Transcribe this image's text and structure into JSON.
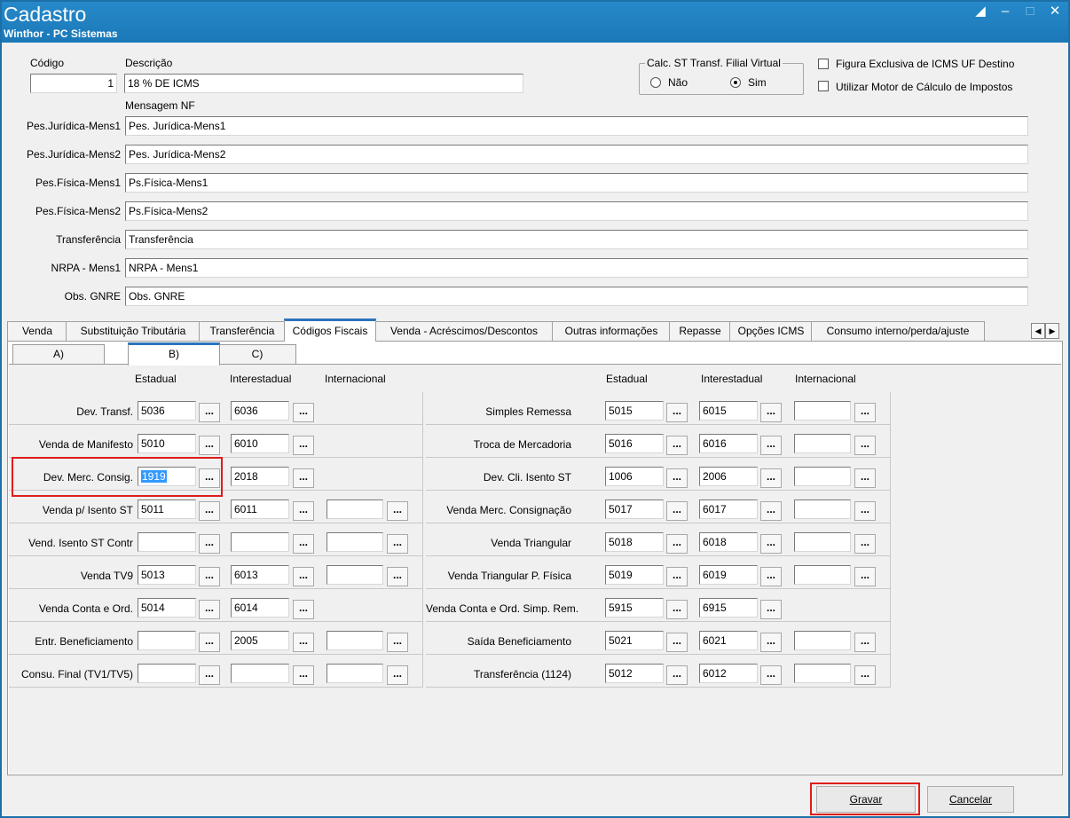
{
  "window": {
    "title": "Cadastro",
    "subtitle": "Winthor - PC Sistemas",
    "icons": [
      "restore-icon",
      "minimize-icon",
      "maximize-icon",
      "close-icon"
    ]
  },
  "header": {
    "codigo_label": "Código",
    "codigo_value": "1",
    "descricao_label": "Descrição",
    "descricao_value": "18 % DE ICMS",
    "calc_st_legend": "Calc. ST Transf. Filial Virtual",
    "radio_nao": "Não",
    "radio_sim": "Sim",
    "radio_selected": "Sim",
    "chk_figura": "Figura Exclusiva de ICMS UF Destino",
    "chk_motor": "Utilizar Motor de Cálculo de Impostos",
    "mensagem_nf_label": "Mensagem NF"
  },
  "messages": [
    {
      "label": "Pes.Jurídica-Mens1",
      "value": "Pes. Jurídica-Mens1"
    },
    {
      "label": "Pes.Jurídica-Mens2",
      "value": "Pes. Jurídica-Mens2"
    },
    {
      "label": "Pes.Física-Mens1",
      "value": "Ps.Física-Mens1"
    },
    {
      "label": "Pes.Física-Mens2",
      "value": "Ps.Física-Mens2"
    },
    {
      "label": "Transferência",
      "value": "Transferência"
    },
    {
      "label": "NRPA - Mens1",
      "value": "NRPA - Mens1"
    },
    {
      "label": "Obs. GNRE",
      "value": "Obs. GNRE"
    }
  ],
  "tabs": [
    "Venda",
    "Substituição Tributária",
    "Transferência",
    "Códigos Fiscais",
    "Venda - Acréscimos/Descontos",
    "Outras informações",
    "Repasse",
    "Opções ICMS",
    "Consumo interno/perda/ajuste"
  ],
  "active_tab": "Códigos Fiscais",
  "subtabs": [
    "A)",
    "B)",
    "C)"
  ],
  "active_subtab": "B)",
  "columns": {
    "estadual": "Estadual",
    "interestadual": "Interestadual",
    "internacional": "Internacional"
  },
  "left_rows": [
    {
      "label": "Dev. Transf.",
      "estadual": "5036",
      "interestadual": "6036",
      "internacional": null
    },
    {
      "label": "Venda de Manifesto",
      "estadual": "5010",
      "interestadual": "6010",
      "internacional": null
    },
    {
      "label": "Dev. Merc. Consig.",
      "estadual": "1919",
      "interestadual": "2018",
      "internacional": null
    },
    {
      "label": "Venda p/ Isento ST",
      "estadual": "5011",
      "interestadual": "6011",
      "internacional": ""
    },
    {
      "label": "Vend. Isento ST Contr",
      "estadual": "",
      "interestadual": "",
      "internacional": ""
    },
    {
      "label": "Venda TV9",
      "estadual": "5013",
      "interestadual": "6013",
      "internacional": ""
    },
    {
      "label": "Venda Conta e Ord.",
      "estadual": "5014",
      "interestadual": "6014",
      "internacional": null
    },
    {
      "label": "Entr. Beneficiamento",
      "estadual": "",
      "interestadual": "2005",
      "internacional": ""
    },
    {
      "label": "Consu. Final (TV1/TV5)",
      "estadual": "",
      "interestadual": "",
      "internacional": ""
    }
  ],
  "right_rows": [
    {
      "label": "Simples Remessa",
      "estadual": "5015",
      "interestadual": "6015",
      "internacional": ""
    },
    {
      "label": "Troca de Mercadoria",
      "estadual": "5016",
      "interestadual": "6016",
      "internacional": ""
    },
    {
      "label": "Dev. Cli. Isento ST",
      "estadual": "1006",
      "interestadual": "2006",
      "internacional": ""
    },
    {
      "label": "Venda Merc. Consignação",
      "estadual": "5017",
      "interestadual": "6017",
      "internacional": ""
    },
    {
      "label": "Venda Triangular",
      "estadual": "5018",
      "interestadual": "6018",
      "internacional": ""
    },
    {
      "label": "Venda Triangular P. Física",
      "estadual": "5019",
      "interestadual": "6019",
      "internacional": ""
    },
    {
      "label": "Venda Conta e Ord. Simp. Rem.",
      "estadual": "5915",
      "interestadual": "6915",
      "internacional": null
    },
    {
      "label": "Saída Beneficiamento",
      "estadual": "5021",
      "interestadual": "6021",
      "internacional": ""
    },
    {
      "label": "Transferência (1124)",
      "estadual": "5012",
      "interestadual": "6012",
      "internacional": ""
    }
  ],
  "lookup_label": "...",
  "buttons": {
    "gravar": "Gravar",
    "cancelar": "Cancelar"
  },
  "colors": {
    "titlebar": "#1b78b8",
    "highlight": "#e01b1b",
    "selection": "#3399ff"
  }
}
